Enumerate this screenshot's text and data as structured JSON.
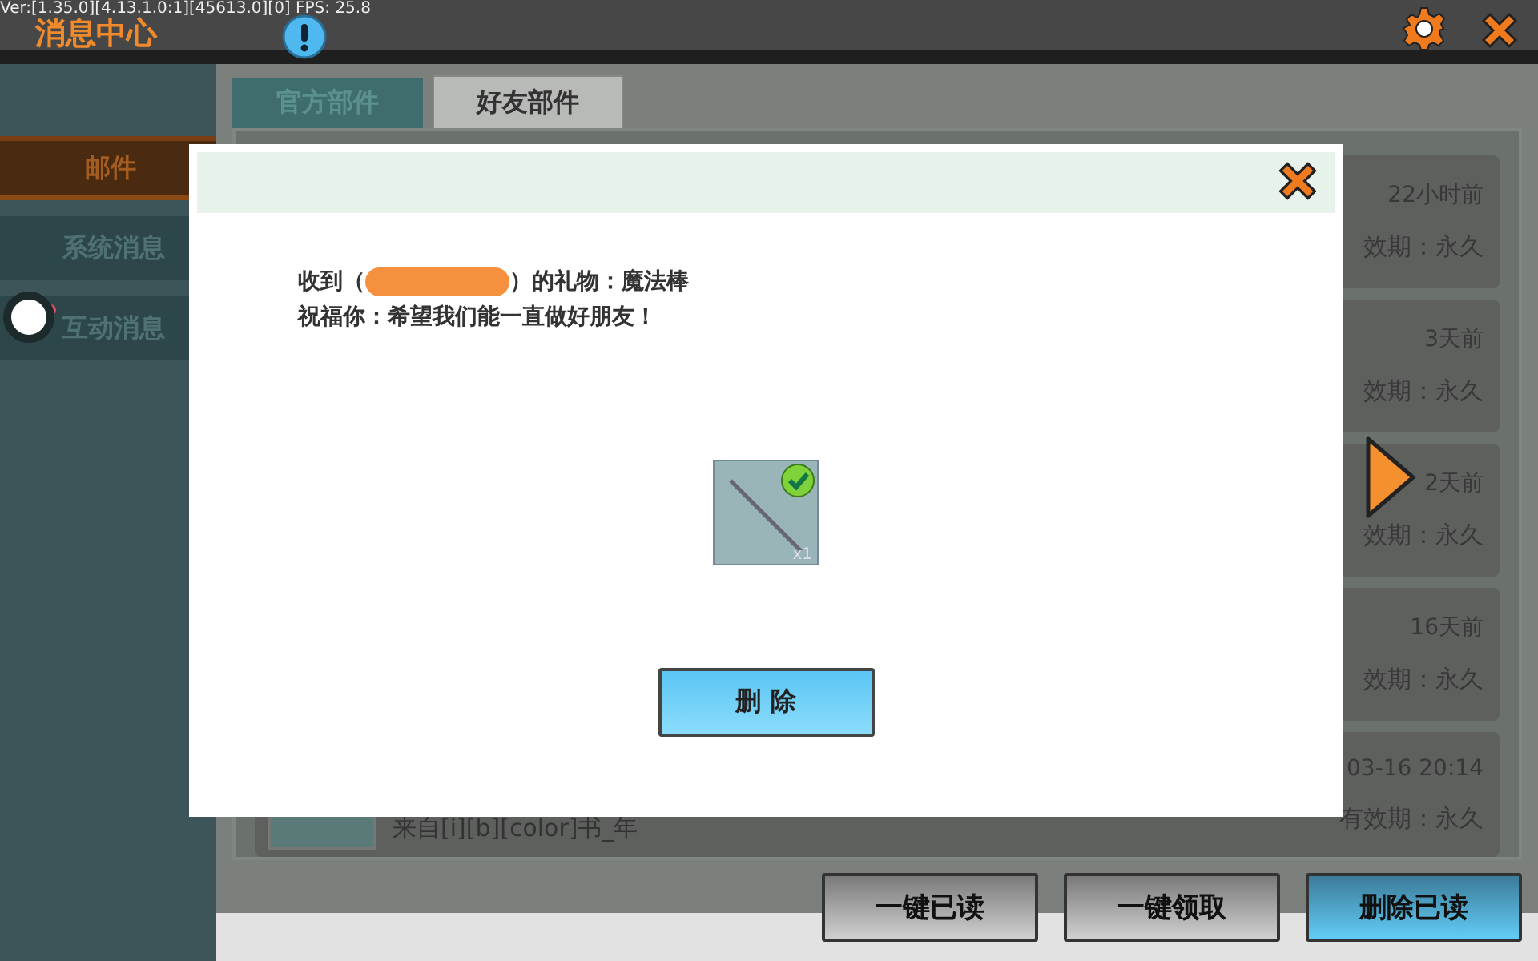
{
  "debug_text": "Ver:[1.35.0][4.13.1.0:1][45613.0][0] FPS: 25.8",
  "header": {
    "title": "消息中心"
  },
  "sidebar": {
    "items": [
      {
        "label": "邮件",
        "selected": true,
        "badge": false
      },
      {
        "label": "系统消息",
        "selected": false,
        "badge": false
      },
      {
        "label": "互动消息",
        "selected": false,
        "badge": true
      }
    ]
  },
  "tabs": [
    {
      "label": "官方部件",
      "selected": false
    },
    {
      "label": "好友部件",
      "selected": true
    }
  ],
  "mails": [
    {
      "time": "22小时前",
      "validity": "效期：永久"
    },
    {
      "time": "3天前",
      "validity": "效期：永久"
    },
    {
      "time": "2天前",
      "validity": "效期：永久"
    },
    {
      "time": "16天前",
      "validity": "效期：永久"
    },
    {
      "sender": "来自[i][b][color]书_年",
      "time": "03-16 20:14",
      "validity": "有效期：永久"
    }
  ],
  "actions": [
    {
      "label": "一键已读",
      "kind": "plain"
    },
    {
      "label": "一键领取",
      "kind": "plain"
    },
    {
      "label": "删除已读",
      "kind": "primary"
    }
  ],
  "dialog": {
    "message_lines": [
      {
        "before": "收到（",
        "after": "）的礼物：魔法棒",
        "redacted": true
      },
      {
        "before": "祝福你：希望我们能一直做好朋友！",
        "redacted": false
      }
    ],
    "item": {
      "count": "x1",
      "claimed": true
    },
    "button": "删 除"
  }
}
